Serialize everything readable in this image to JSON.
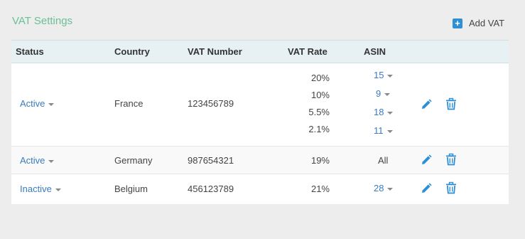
{
  "title": "VAT Settings",
  "add_button": {
    "label": "Add VAT",
    "icon": "plus-square-icon"
  },
  "columns": [
    "Status",
    "Country",
    "VAT Number",
    "VAT Rate",
    "ASIN"
  ],
  "rows": [
    {
      "status": "Active",
      "country": "France",
      "vat_number": "123456789",
      "rates": [
        {
          "rate": "20%",
          "asin": "15"
        },
        {
          "rate": "10%",
          "asin": "9"
        },
        {
          "rate": "5.5%",
          "asin": "18"
        },
        {
          "rate": "2.1%",
          "asin": "11"
        }
      ]
    },
    {
      "status": "Active",
      "country": "Germany",
      "vat_number": "987654321",
      "rates": [
        {
          "rate": "19%",
          "asin": "All"
        }
      ]
    },
    {
      "status": "Inactive",
      "country": "Belgium",
      "vat_number": "456123789",
      "rates": [
        {
          "rate": "21%",
          "asin": "28"
        }
      ]
    }
  ],
  "colors": {
    "title": "#6cbf96",
    "accent": "#2e8fd4",
    "link": "#3a7bbf",
    "header_bg": "#e7f1f4"
  }
}
